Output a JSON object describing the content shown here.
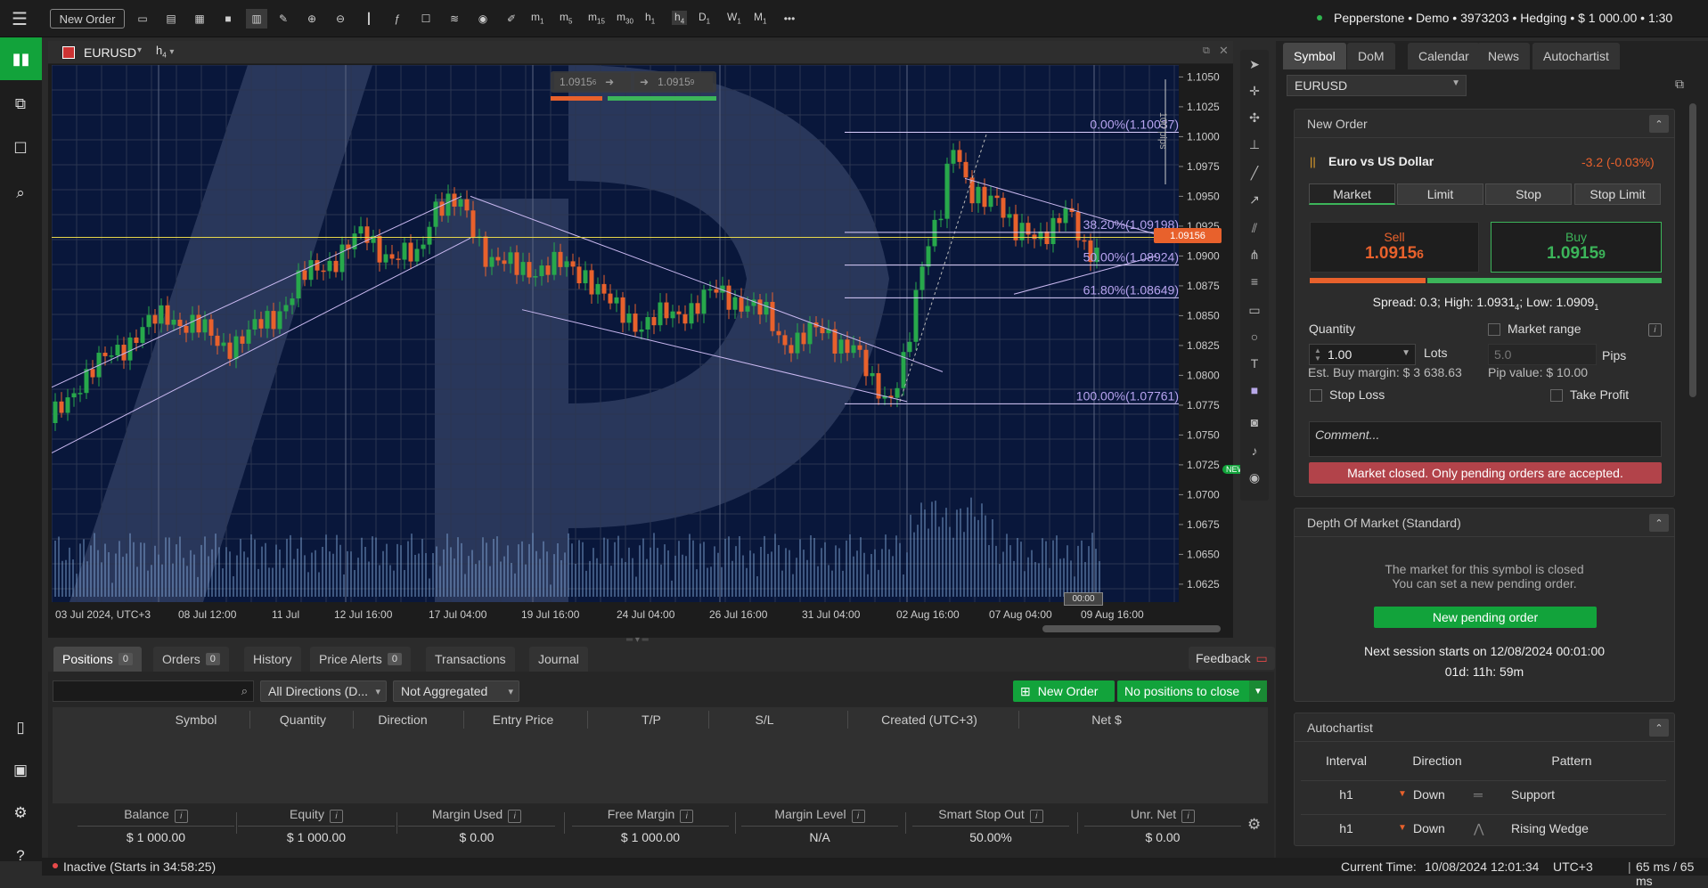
{
  "toolbar": {
    "new_order": "New Order",
    "timeframes": [
      {
        "l": "m",
        "s": "1"
      },
      {
        "l": "m",
        "s": "5"
      },
      {
        "l": "m",
        "s": "15"
      },
      {
        "l": "m",
        "s": "30"
      },
      {
        "l": "h",
        "s": "1"
      },
      {
        "l": "h",
        "s": "4"
      },
      {
        "l": "D",
        "s": "1"
      },
      {
        "l": "W",
        "s": "1"
      },
      {
        "l": "M",
        "s": "1"
      }
    ],
    "more": "•••",
    "account": "Pepperstone • Demo • 3973203 • Hedging • $ 1 000.00 • 1:30"
  },
  "chart": {
    "symbol": "EURUSD",
    "timeframe": "h",
    "timeframe_sub": "4",
    "quick_sell": "1.0915",
    "quick_sell_pip": "6",
    "quick_buy": "1.0915",
    "quick_buy_pip": "9",
    "current_price": "1.09156",
    "pips_label": "100 pips",
    "cursor_time": "00:00",
    "new_badge": "NEW",
    "price_ticks": [
      "1.1050",
      "1.1025",
      "1.1000",
      "1.0975",
      "1.0950",
      "1.0925",
      "1.0900",
      "1.0875",
      "1.0850",
      "1.0825",
      "1.0800",
      "1.0775",
      "1.0750",
      "1.0725",
      "1.0700",
      "1.0675",
      "1.0650",
      "1.0625"
    ],
    "time_ticks": [
      "03 Jul 2024, UTC+3",
      "08 Jul 12:00",
      "11 Jul",
      "12 Jul 16:00",
      "17 Jul 04:00",
      "19 Jul 16:00",
      "24 Jul 04:00",
      "26 Jul 16:00",
      "31 Jul 04:00",
      "02 Aug 16:00",
      "07 Aug 04:00",
      "09 Aug 16:00"
    ],
    "fib": [
      "0.00%(1.10037)",
      "38.20%(1.09198)",
      "50.00%(1.08924)",
      "61.80%(1.08649)",
      "100.00%(1.07761)"
    ]
  },
  "right": {
    "tabs": [
      "Symbol",
      "DoM",
      "Calendar",
      "News",
      "Autochartist"
    ],
    "symbol_select": "EURUSD",
    "new_order": {
      "title": "New Order",
      "name": "Euro vs US Dollar",
      "change": "-3.2 (-0.03%)",
      "types": [
        "Market",
        "Limit",
        "Stop",
        "Stop Limit"
      ],
      "sell_label": "Sell",
      "sell_price": "1.0915",
      "sell_pip": "6",
      "buy_label": "Buy",
      "buy_price": "1.0915",
      "buy_pip": "9",
      "spread": "Spread: 0.3; High: 1.0931",
      "spread_high_pip": "4",
      "spread_low": "; Low: 1.0909",
      "spread_low_pip": "1",
      "quantity_label": "Quantity",
      "quantity": "1.00",
      "lots": "Lots",
      "market_range": "Market range",
      "range_value": "5.0",
      "pips": "Pips",
      "margin": "Est. Buy margin: $ 3 638.63",
      "pip_value": "Pip value: $ 10.00",
      "stop_loss": "Stop Loss",
      "take_profit": "Take Profit",
      "comment_placeholder": "Comment...",
      "notice": "Market closed. Only pending orders are accepted."
    },
    "dom": {
      "title": "Depth Of Market (Standard)",
      "line1": "The market for this symbol is closed",
      "line2": "You can set a new pending order.",
      "button": "New pending order",
      "session": "Next session starts on 12/08/2024 00:01:00",
      "countdown": "01d: 11h: 59m"
    },
    "autochartist": {
      "title": "Autochartist",
      "headers": [
        "Interval",
        "Direction",
        "Pattern"
      ],
      "rows": [
        {
          "interval": "h1",
          "direction": "Down",
          "pattern": "Support"
        },
        {
          "interval": "h1",
          "direction": "Down",
          "pattern": "Rising Wedge"
        }
      ]
    }
  },
  "bottom": {
    "tabs": [
      {
        "label": "Positions",
        "count": "0"
      },
      {
        "label": "Orders",
        "count": "0"
      },
      {
        "label": "History",
        "count": ""
      },
      {
        "label": "Price Alerts",
        "count": "0"
      },
      {
        "label": "Transactions",
        "count": ""
      },
      {
        "label": "Journal",
        "count": ""
      }
    ],
    "feedback": "Feedback",
    "filter_direction": "All Directions (D...",
    "filter_agg": "Not Aggregated",
    "new_order": "New Order",
    "close_all": "No positions to close",
    "columns": [
      "Symbol",
      "Quantity",
      "Direction",
      "Entry Price",
      "T/P",
      "S/L",
      "Created (UTC+3)",
      "Net $"
    ],
    "summary": [
      {
        "label": "Balance",
        "value": "$ 1 000.00"
      },
      {
        "label": "Equity",
        "value": "$ 1 000.00"
      },
      {
        "label": "Margin Used",
        "value": "$ 0.00"
      },
      {
        "label": "Free Margin",
        "value": "$ 1 000.00"
      },
      {
        "label": "Margin Level",
        "value": "N/A"
      },
      {
        "label": "Smart Stop Out",
        "value": "50.00%"
      },
      {
        "label": "Unr. Net",
        "value": "$ 0.00"
      }
    ]
  },
  "status": {
    "state": "Inactive (Starts in 34:58:25)",
    "time_label": "Current Time:",
    "time": "10/08/2024 12:01:34",
    "tz": "UTC+3",
    "latency": "65 ms / 65 ms"
  },
  "colors": {
    "sell": "#e8612c",
    "buy": "#3cb55a",
    "notice": "#b2434a",
    "accent_green": "#12a33b"
  }
}
